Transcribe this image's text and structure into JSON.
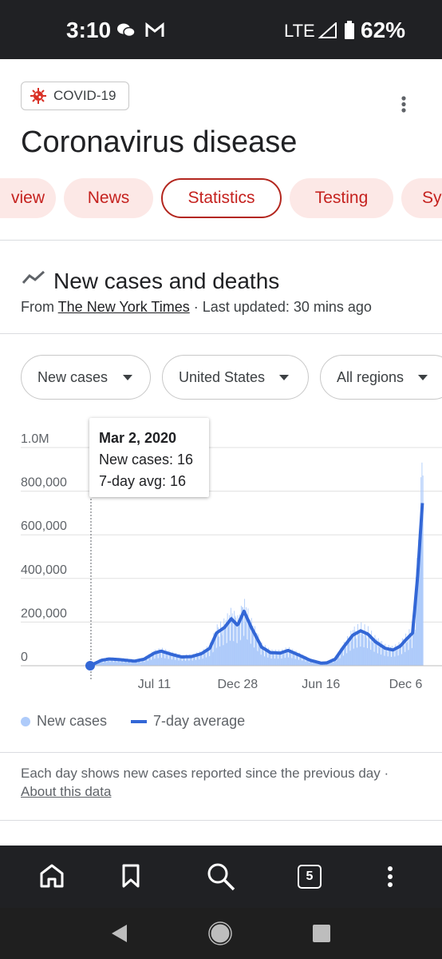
{
  "status_bar": {
    "time": "3:10",
    "network": "LTE",
    "battery": "62%"
  },
  "topic_chip": {
    "label": "COVID-19"
  },
  "page_title": "Coronavirus disease",
  "tabs": [
    {
      "label": "view",
      "active": false
    },
    {
      "label": "News",
      "active": false
    },
    {
      "label": "Statistics",
      "active": true
    },
    {
      "label": "Testing",
      "active": false
    },
    {
      "label": "Sy",
      "active": false
    }
  ],
  "section": {
    "title": "New cases and deaths",
    "source_prefix": "From ",
    "source_name": "The New York Times",
    "last_updated": " · Last updated: 30 mins ago"
  },
  "filters": {
    "metric": "New cases",
    "country": "United States",
    "region": "All regions"
  },
  "tooltip": {
    "date": "Mar 2, 2020",
    "new_cases": "New cases: 16",
    "avg": "7-day avg: 16"
  },
  "legend": {
    "bars": "New cases",
    "line": "7-day average"
  },
  "note": {
    "text": "Each day shows new cases reported since the previous day",
    "separator": " · ",
    "link": "About this data"
  },
  "bottom_nav": {
    "tabs_count": "5"
  },
  "colors": {
    "accent": "#c5221f",
    "bar": "#aecbfa",
    "line": "#3367d6"
  },
  "chart_data": {
    "type": "bar",
    "y_tick_labels": [
      "0",
      "200,000",
      "400,000",
      "600,000",
      "800,000",
      "1.0M"
    ],
    "y_ticks": [
      0,
      200000,
      400000,
      600000,
      800000,
      1000000
    ],
    "ylim": [
      0,
      1000000
    ],
    "x_tick_labels": [
      "Jul 11",
      "Dec 28",
      "Jun 16",
      "Dec 6"
    ],
    "x_tick_dates": [
      "2020-07-11",
      "2020-12-28",
      "2021-06-16",
      "2021-12-06"
    ],
    "xlim": [
      "2020-03-02",
      "2022-01-10"
    ],
    "series": [
      {
        "name": "7-day average",
        "style": "line"
      },
      {
        "name": "New cases",
        "style": "bar"
      }
    ],
    "seven_day_average": [
      [
        "2020-03-02",
        16
      ],
      [
        "2020-03-25",
        25000
      ],
      [
        "2020-04-10",
        31000
      ],
      [
        "2020-05-01",
        28000
      ],
      [
        "2020-06-01",
        21000
      ],
      [
        "2020-06-20",
        30000
      ],
      [
        "2020-07-11",
        58000
      ],
      [
        "2020-07-25",
        67000
      ],
      [
        "2020-08-15",
        52000
      ],
      [
        "2020-09-05",
        40000
      ],
      [
        "2020-09-25",
        42000
      ],
      [
        "2020-10-15",
        55000
      ],
      [
        "2020-11-01",
        80000
      ],
      [
        "2020-11-15",
        150000
      ],
      [
        "2020-12-01",
        175000
      ],
      [
        "2020-12-15",
        215000
      ],
      [
        "2020-12-28",
        185000
      ],
      [
        "2021-01-10",
        250000
      ],
      [
        "2021-01-25",
        175000
      ],
      [
        "2021-02-15",
        85000
      ],
      [
        "2021-03-05",
        60000
      ],
      [
        "2021-03-25",
        58000
      ],
      [
        "2021-04-10",
        70000
      ],
      [
        "2021-05-01",
        50000
      ],
      [
        "2021-05-25",
        25000
      ],
      [
        "2021-06-16",
        12000
      ],
      [
        "2021-06-28",
        13000
      ],
      [
        "2021-07-15",
        30000
      ],
      [
        "2021-08-01",
        85000
      ],
      [
        "2021-08-20",
        140000
      ],
      [
        "2021-09-05",
        160000
      ],
      [
        "2021-09-20",
        145000
      ],
      [
        "2021-10-05",
        110000
      ],
      [
        "2021-10-25",
        80000
      ],
      [
        "2021-11-10",
        72000
      ],
      [
        "2021-11-25",
        90000
      ],
      [
        "2021-12-06",
        118000
      ],
      [
        "2021-12-20",
        150000
      ],
      [
        "2021-12-30",
        400000
      ],
      [
        "2022-01-10",
        780000
      ]
    ]
  }
}
